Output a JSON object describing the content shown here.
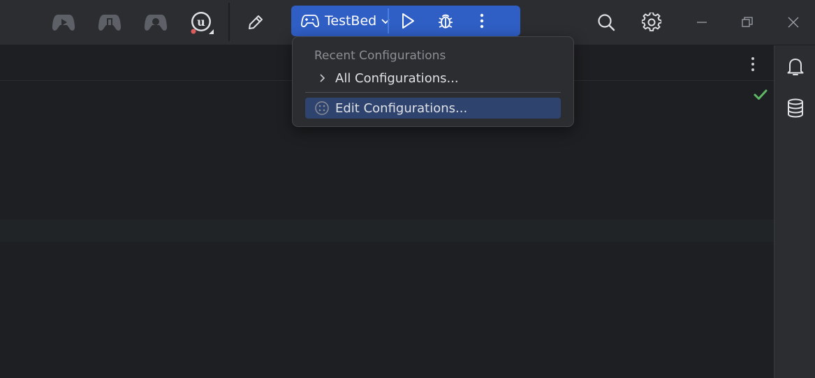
{
  "colors": {
    "toolbar_bg": "#2b2d30",
    "editor_bg": "#1e1f22",
    "run_widget_accent": "#2f5ec4",
    "selection": "#2e436e",
    "ok_check": "#5fb865",
    "unreal_dot": "#db5c5c"
  },
  "toolbar": {
    "left_icons": [
      {
        "icon": "gamepad-play-icon"
      },
      {
        "icon": "gamepad-build-icon"
      },
      {
        "icon": "gamepad-debug-icon"
      },
      {
        "icon": "unreal-engine-icon"
      }
    ],
    "edit_icon": "pencil-icon",
    "run_widget": {
      "config_icon": "gamepad-icon",
      "config_label": "TestBed",
      "dropdown_icon": "chevron-down-icon",
      "run_icon": "play-icon",
      "debug_icon": "bug-icon",
      "more_icon": "more-vertical-icon"
    },
    "right_icons": [
      {
        "icon": "search-icon"
      },
      {
        "icon": "gear-icon"
      }
    ],
    "window_controls": {
      "minimize_icon": "minimize-icon",
      "restore_icon": "restore-icon",
      "close_icon": "close-icon"
    }
  },
  "editor": {
    "more_icon": "more-vertical-icon",
    "status_icon": "checkmark-icon"
  },
  "right_strip": [
    {
      "icon": "bell-icon"
    },
    {
      "icon": "database-icon"
    }
  ],
  "popup": {
    "heading": "Recent Configurations",
    "items": [
      {
        "label": "All Configurations...",
        "icon": "chevron-right-icon",
        "selected": false
      },
      {
        "label": "Edit Configurations...",
        "icon": "settings-dots-icon",
        "selected": true
      }
    ]
  }
}
